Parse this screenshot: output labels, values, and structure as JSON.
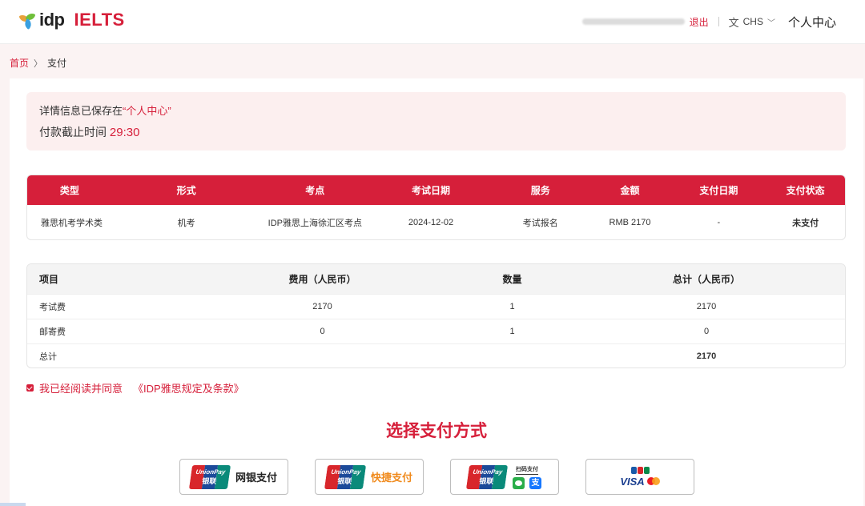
{
  "header": {
    "logo_text": "idp",
    "logo_brand": "IELTS",
    "logout": "退出",
    "language": "CHS",
    "user_center": "个人中心"
  },
  "breadcrumb": {
    "home": "首页",
    "current": "支付"
  },
  "notice": {
    "saved_prefix": "详情信息已保存在",
    "saved_link": "“个人中心”",
    "deadline_label": "付款截止时间",
    "deadline_value": "29:30"
  },
  "order_table": {
    "headers": [
      "类型",
      "形式",
      "考点",
      "考试日期",
      "服务",
      "金额",
      "支付日期",
      "支付状态"
    ],
    "row": [
      "雅思机考学术类",
      "机考",
      "IDP雅思上海徐汇区考点",
      "2024-12-02",
      "考试报名",
      "RMB 2170",
      "-",
      "未支付"
    ]
  },
  "fee_table": {
    "headers": [
      "项目",
      "费用（人民币）",
      "数量",
      "总计（人民币）"
    ],
    "rows": [
      [
        "考试费",
        "2170",
        "1",
        "2170"
      ],
      [
        "邮寄费",
        "0",
        "1",
        "0"
      ]
    ],
    "total_label": "总计",
    "total_value": "2170"
  },
  "agreement": {
    "text": "我已经阅读并同意",
    "link": "《IDP雅思规定及条款》",
    "checked": true
  },
  "payment": {
    "title": "选择支付方式",
    "options": [
      {
        "label": "网银支付",
        "logo_top": "UnionPay",
        "logo_bottom": "银联"
      },
      {
        "label": "快捷支付",
        "logo_top": "UnionPay",
        "logo_bottom": "银联"
      },
      {
        "label": "扫码支付",
        "logo_top": "UnionPay",
        "logo_bottom": "银联"
      },
      {
        "label": "VISA"
      }
    ]
  },
  "colors": {
    "brand_red": "#d61f3a",
    "page_bg": "#fbf3f3"
  }
}
